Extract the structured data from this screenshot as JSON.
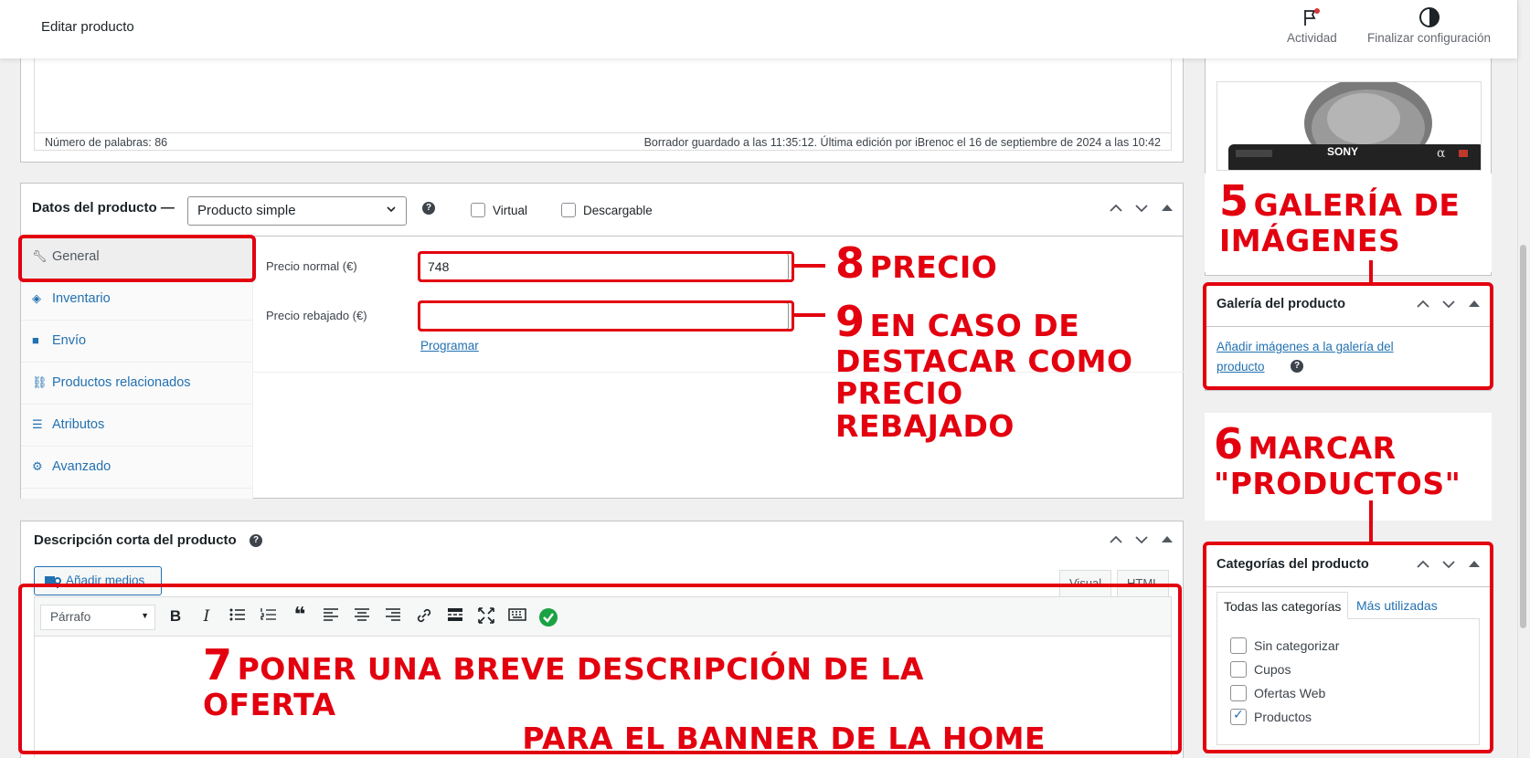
{
  "topbar": {
    "title": "Editar producto",
    "activity_label": "Actividad",
    "finish_label": "Finalizar configuración"
  },
  "editor_status": {
    "word_count": "Número de palabras: 86",
    "draft_saved": "Borrador guardado a las 11:35:12. Última edición por iBrenoc el 16 de septiembre de 2024 a las 10:42"
  },
  "product_data": {
    "label": "Datos del producto —",
    "type_value": "Producto simple",
    "virtual_label": "Virtual",
    "downloadable_label": "Descargable",
    "tabs": [
      {
        "label": "General",
        "icon": "wrench-icon"
      },
      {
        "label": "Inventario",
        "icon": "tag-icon"
      },
      {
        "label": "Envío",
        "icon": "truck-icon"
      },
      {
        "label": "Productos relacionados",
        "icon": "link-icon"
      },
      {
        "label": "Atributos",
        "icon": "list-icon"
      },
      {
        "label": "Avanzado",
        "icon": "gear-icon"
      }
    ],
    "regular_price_label": "Precio normal (€)",
    "regular_price_value": "748",
    "sale_price_label": "Precio rebajado (€)",
    "sale_price_value": "",
    "schedule_link": "Programar"
  },
  "short_description": {
    "label": "Descripción corta del producto",
    "add_media": "Añadir medios",
    "tab_visual": "Visual",
    "tab_html": "HTML",
    "paragraph_select": "Párrafo"
  },
  "sidebar": {
    "gallery_title": "Galería del producto",
    "gallery_link_line1": "Añadir imágenes a la galería del",
    "gallery_link_line2": "producto",
    "categories_title": "Categorías del producto",
    "cat_tab_all": "Todas las categorías",
    "cat_tab_most": "Más utilizadas",
    "categories": [
      {
        "label": "Sin categorizar",
        "checked": false
      },
      {
        "label": "Cupos",
        "checked": false
      },
      {
        "label": "Ofertas Web",
        "checked": false
      },
      {
        "label": "Productos",
        "checked": true
      }
    ],
    "camera_brand": "SONY"
  },
  "annotations": {
    "a5_num": "5",
    "a5_line1": "GALERÍA DE",
    "a5_line2": "IMÁGENES",
    "a6_num": "6",
    "a6_line1": "MARCAR",
    "a6_line2": "\"PRODUCTOS\"",
    "a7_num": "7",
    "a7_line1": "PONER UNA BREVE DESCRIPCIÓN DE LA OFERTA",
    "a7_line2": "PARA EL BANNER DE LA HOME",
    "a8_num": "8",
    "a8_text": "PRECIO",
    "a9_num": "9",
    "a9_line1": "EN CASO DE",
    "a9_line2": "DESTACAR COMO",
    "a9_line3": "PRECIO",
    "a9_line4": "REBAJADO"
  },
  "colors": {
    "annotation_red": "#e3000f",
    "link_blue": "#2271b1",
    "check_green": "#1aa244"
  }
}
